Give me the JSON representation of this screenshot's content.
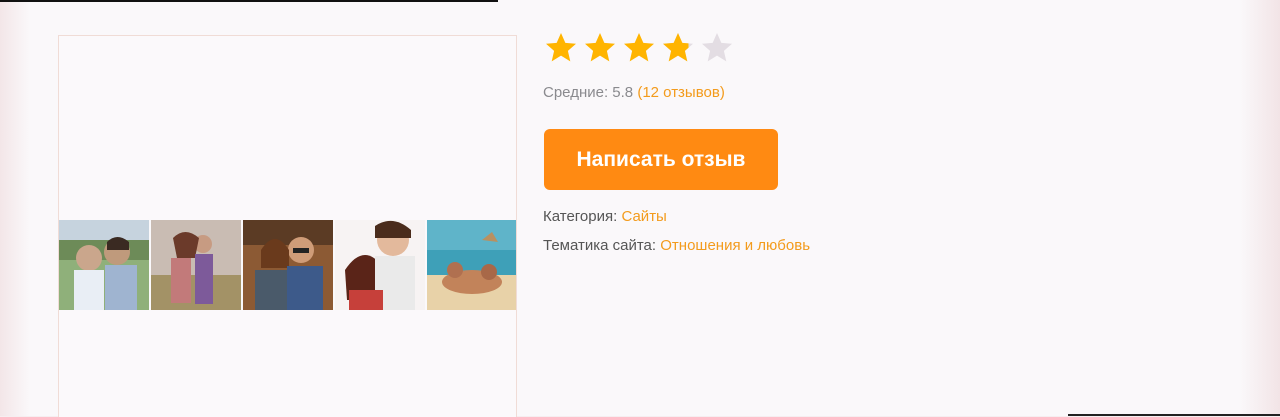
{
  "rating": {
    "value_fraction": 0.76,
    "stars_total": 5,
    "stars_filled": 3.8,
    "star_color": "#ffb400",
    "star_empty_color": "#e3dde3"
  },
  "average": {
    "label": "Средние:",
    "value": "5.8",
    "reviews_text": "(12 отзывов)"
  },
  "write_review_button": "Написать отзыв",
  "category": {
    "label": "Категория:",
    "value": "Сайты"
  },
  "topic": {
    "label": "Тематика сайта:",
    "value": "Отношения и любовь"
  },
  "photos": [
    {
      "name": "couple-photo-1"
    },
    {
      "name": "couple-photo-2"
    },
    {
      "name": "couple-photo-3"
    },
    {
      "name": "couple-photo-4"
    },
    {
      "name": "beach-photo"
    }
  ],
  "colors": {
    "accent": "#ff8a12",
    "link": "#f39b1c"
  }
}
